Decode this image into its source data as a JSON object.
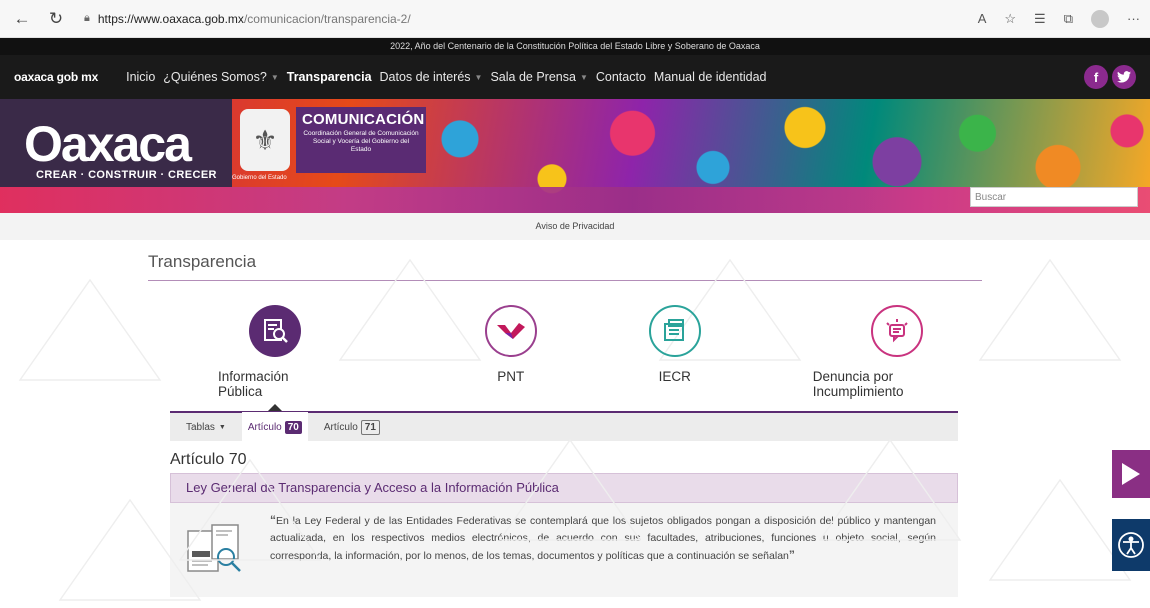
{
  "browser": {
    "url_host": "https://www.oaxaca.gob.mx",
    "url_path": "/comunicacion/transparencia-2/"
  },
  "announcement": "2022, Año del Centenario de la Constitución Política del Estado Libre y Soberano de Oaxaca",
  "nav": {
    "brand": "oaxaca gob mx",
    "items": [
      {
        "label": "Inicio",
        "dropdown": false
      },
      {
        "label": "¿Quiénes Somos?",
        "dropdown": true
      },
      {
        "label": "Transparencia",
        "dropdown": false,
        "active": true
      },
      {
        "label": "Datos de interés",
        "dropdown": true
      },
      {
        "label": "Sala de Prensa",
        "dropdown": true
      },
      {
        "label": "Contacto",
        "dropdown": false
      },
      {
        "label": "Manual de identidad",
        "dropdown": false
      }
    ],
    "social": [
      "f",
      "t"
    ]
  },
  "banner": {
    "logo": "Oaxaca",
    "tagline": "CREAR · CONSTRUIR · CRECER",
    "seal_label": "Gobierno del Estado",
    "com_title": "COMUNICACIÓN",
    "com_sub": "Coordinación General de Comunicación Social y Vocería del Gobierno del Estado",
    "search_placeholder": "Buscar"
  },
  "privacy": "Aviso de Privacidad",
  "page_title": "Transparencia",
  "sections": [
    {
      "label": "Información Pública",
      "icon": "search-doc-icon"
    },
    {
      "label": "PNT",
      "icon": "pnt-logo-icon"
    },
    {
      "label": "IECR",
      "icon": "folder-icon"
    },
    {
      "label": "Denuncia por Incumplimiento",
      "icon": "alert-chat-icon"
    }
  ],
  "tabs": {
    "tables": "Tablas",
    "articulo_label": "Artículo",
    "art70": "70",
    "art71": "71"
  },
  "article_title": "Artículo 70",
  "law_title": "Ley General de Transparencia y Acceso a la Información Pública",
  "law_text": "En la Ley Federal y de las Entidades Federativas se contemplará que los sujetos obligados pongan a disposición del público y mantengan actualizada, en los respectivos medios electrónicos, de acuerdo con sus facultades, atribuciones, funciones u objeto social, según corresponda, la información, por lo menos, de los temas, documentos y políticas que a continuación se señalan",
  "colors": {
    "brand_purple": "#5b2b72",
    "accent_magenta": "#8a2f84",
    "teal": "#2aa39a",
    "pink": "#c9337f",
    "access_blue": "#0e3a6a"
  }
}
